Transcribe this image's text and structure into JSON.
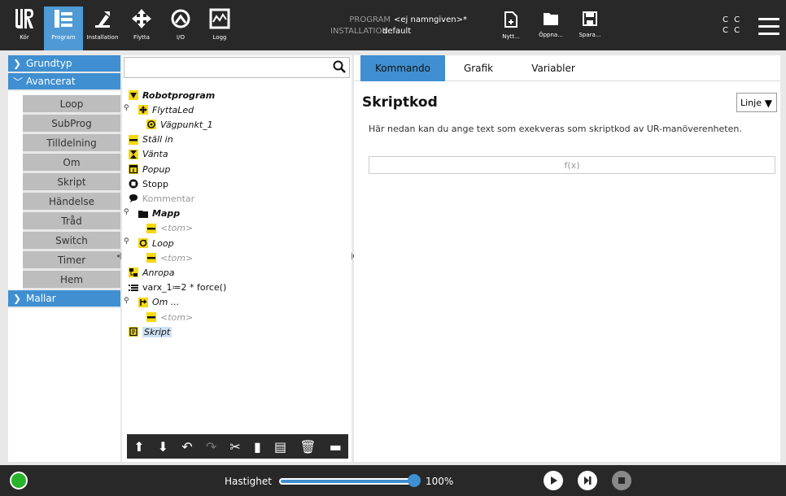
{
  "topbar": {
    "nav": [
      {
        "key": "run",
        "label": "Kör",
        "icon": "ur-logo-icon"
      },
      {
        "key": "program",
        "label": "Program",
        "icon": "program-icon"
      },
      {
        "key": "installation",
        "label": "Installation",
        "icon": "installation-icon"
      },
      {
        "key": "move",
        "label": "Flytta",
        "icon": "move-icon"
      },
      {
        "key": "io",
        "label": "I/O",
        "icon": "io-icon"
      },
      {
        "key": "log",
        "label": "Logg",
        "icon": "log-icon"
      }
    ],
    "program_label": "PROGRAM",
    "program_value": "<ej namngiven>*",
    "installation_label": "INSTALLATION",
    "installation_value": "default",
    "file_buttons": [
      {
        "key": "new",
        "label": "Nytt..."
      },
      {
        "key": "open",
        "label": "Öppna..."
      },
      {
        "key": "save",
        "label": "Spara..."
      }
    ],
    "status_c": [
      "C C",
      "C C"
    ]
  },
  "sidebar": {
    "basic": "Grundtyp",
    "advanced": "Avancerat",
    "advanced_items": [
      "Loop",
      "SubProg",
      "Tilldelning",
      "Om",
      "Skript",
      "Händelse",
      "Tråd",
      "Switch",
      "Timer",
      "Hem"
    ],
    "templates": "Mallar"
  },
  "tree": {
    "nodes": [
      {
        "label": "Robotprogram",
        "style": "bold-it",
        "icon": "triangle-down-icon",
        "level": 0
      },
      {
        "label": "FlyttaLed",
        "style": "it",
        "icon": "move-icon",
        "level": 0,
        "pin": true
      },
      {
        "label": "Vägpunkt_1",
        "style": "it",
        "icon": "waypoint-icon",
        "level": 1
      },
      {
        "label": "Ställ in",
        "style": "it",
        "icon": "set-icon",
        "level": 0
      },
      {
        "label": "Vänta",
        "style": "it",
        "icon": "wait-icon",
        "level": 0
      },
      {
        "label": "Popup",
        "style": "it",
        "icon": "popup-icon",
        "level": 0
      },
      {
        "label": "Stopp",
        "style": "",
        "icon": "stop-icon",
        "level": 0
      },
      {
        "label": "Kommentar",
        "style": "gr",
        "icon": "comment-icon",
        "level": 0
      },
      {
        "label": "Mapp",
        "style": "bold-it",
        "icon": "folder-icon",
        "level": 0,
        "pin": true
      },
      {
        "label": "<tom>",
        "style": "gr-it",
        "icon": "empty-icon",
        "level": 1
      },
      {
        "label": "Loop",
        "style": "it",
        "icon": "loop-icon",
        "level": 0,
        "pin": true
      },
      {
        "label": "<tom>",
        "style": "gr-it",
        "icon": "empty-icon",
        "level": 1
      },
      {
        "label": "Anropa",
        "style": "it",
        "icon": "call-icon",
        "level": 0
      },
      {
        "label": "varx_1≔2 * force()",
        "style": "",
        "icon": "assign-icon",
        "level": 0
      },
      {
        "label": "Om ...",
        "style": "it",
        "icon": "if-icon",
        "level": 0,
        "pin": true
      },
      {
        "label": "<tom>",
        "style": "gr-it",
        "icon": "empty-icon",
        "level": 1
      },
      {
        "label": "Skript",
        "style": "it-sel",
        "icon": "script-icon",
        "level": 0
      }
    ],
    "toolbar_icons": [
      "move-up-icon",
      "move-down-icon",
      "undo-icon",
      "redo-icon",
      "cut-icon",
      "copy-icon",
      "paste-icon",
      "delete-icon",
      "suppress-icon"
    ]
  },
  "tabs": [
    "Kommando",
    "Grafik",
    "Variabler"
  ],
  "main": {
    "title": "Skriptkod",
    "dropdown_value": "Linje",
    "description": "Här nedan kan du ange text som exekveras som skriptkod av UR-manöverenheten.",
    "fx_placeholder": "f(x)"
  },
  "bottombar": {
    "speed_label": "Hastighet",
    "speed_value": "100%",
    "speed_fraction": 1.0
  },
  "colors": {
    "accent": "#3f8fd1",
    "yellow": "#f5d90f",
    "dark": "#282828",
    "power": "#27b42a"
  }
}
